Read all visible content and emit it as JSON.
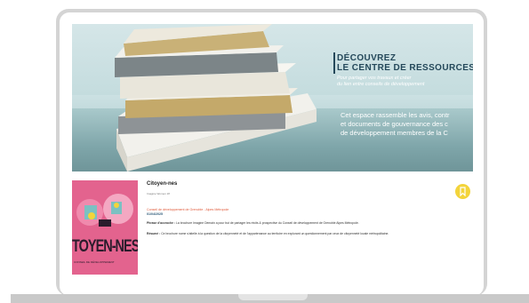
{
  "hero": {
    "title": "DÉCOUVREZ\nLE CENTRE DE RESSOURCES",
    "subtitle": "Pour partager vos travaux et créer\ndu lien entre conseils de développement",
    "description": "Cet espace rassemble les avis, contr\net documents de gouvernance des c\nde développement membres de la C"
  },
  "card": {
    "cover_word": "ITOYEN-NES",
    "cover_small": "CONSEIL DE DÉVELOPPEMENT",
    "title": "Citoyen-nes",
    "author": "Imagine Women 1ff",
    "org": "Conseil de développement de Grenoble - Alpes Métropole",
    "date": "01/04/2025",
    "line1_label": "Phrase d'accroche :",
    "line1_text": " La brochure Imagine Demain a pour but de partager les récits & prospective du Conseil de développement de Grenoble Alpes Métropole.",
    "line2_label": "Résumé :",
    "line2_text": " Ce brochure nome s'attelle à la question de la citoyenneté et de l'appartenance au territoire en explorant un questionnement par ceux de citoyenneté locale métropolitaine."
  },
  "colors": {
    "accent_title": "#24485a",
    "cover_pink": "#e3638e",
    "badge_yellow": "#f3d43b",
    "org_orange": "#e05a3a"
  },
  "icons": [
    "bookmark-icon"
  ]
}
